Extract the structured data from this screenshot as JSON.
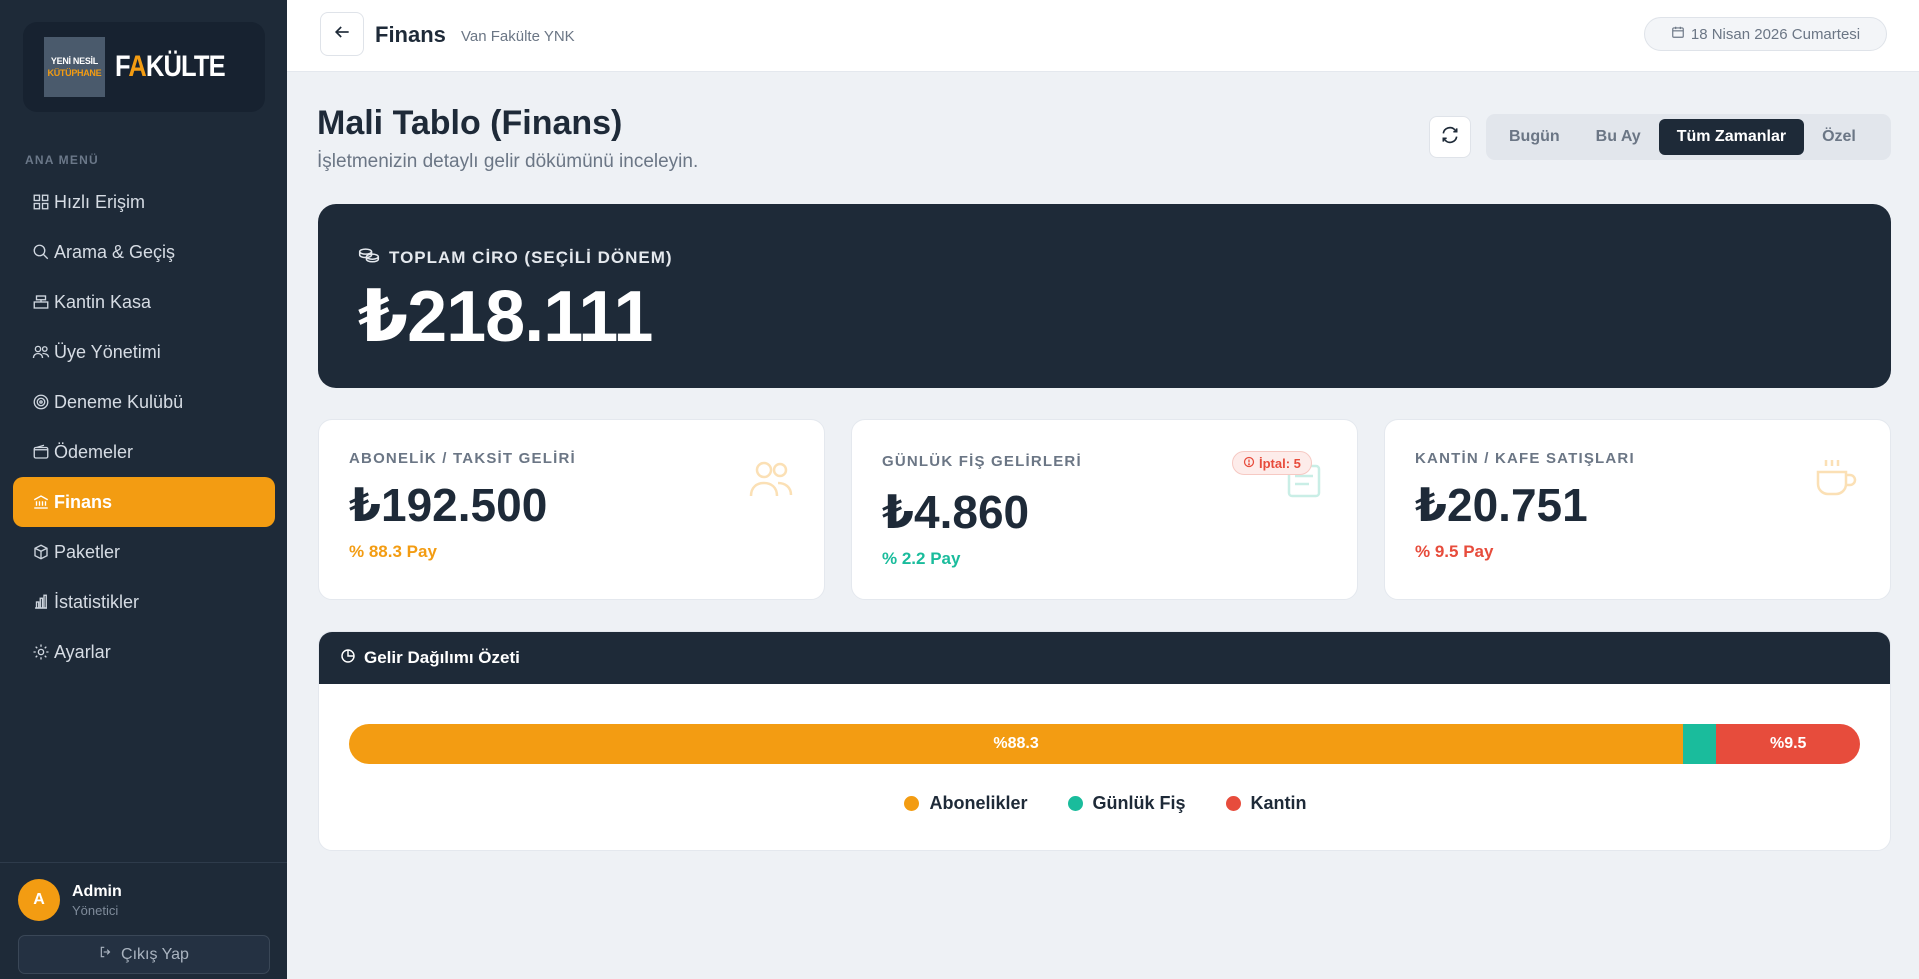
{
  "colors": {
    "accent": "#f39c12",
    "dark": "#1e2a38",
    "teal": "#1abc9c",
    "red": "#e74c3c"
  },
  "sidebar": {
    "logo": {
      "badge_line1": "YENİ NESİL",
      "badge_line2": "KÜTÜPHANE",
      "word_a": "F",
      "word_b": "A",
      "word_c": "KÜLTE"
    },
    "menu_label": "ANA MENÜ",
    "items": [
      {
        "label": "Hızlı Erişim",
        "icon": "grid-icon"
      },
      {
        "label": "Arama & Geçiş",
        "icon": "search-icon"
      },
      {
        "label": "Kantin Kasa",
        "icon": "cash-register-icon"
      },
      {
        "label": "Üye Yönetimi",
        "icon": "users-icon"
      },
      {
        "label": "Deneme Kulübü",
        "icon": "target-icon"
      },
      {
        "label": "Ödemeler",
        "icon": "wallet-icon"
      },
      {
        "label": "Finans",
        "icon": "bank-icon",
        "active": true
      },
      {
        "label": "Paketler",
        "icon": "package-icon"
      },
      {
        "label": "İstatistikler",
        "icon": "bar-chart-icon"
      },
      {
        "label": "Ayarlar",
        "icon": "gear-icon"
      }
    ],
    "user": {
      "initial": "A",
      "name": "Admin",
      "role": "Yönetici"
    },
    "logout_label": "Çıkış Yap"
  },
  "topbar": {
    "title": "Finans",
    "subtitle": "Van Fakülte YNK",
    "date": "18 Nisan 2026 Cumartesi"
  },
  "page": {
    "title": "Mali Tablo (Finans)",
    "subtitle": "İşletmenizin detaylı gelir dökümünü inceleyin.",
    "periods": [
      "Bugün",
      "Bu Ay",
      "Tüm Zamanlar",
      "Özel"
    ],
    "active_period": "Tüm Zamanlar"
  },
  "total": {
    "label": "TOPLAM CİRO (SEÇİLİ DÖNEM)",
    "value": "₺218.111"
  },
  "stats": [
    {
      "label": "ABONELİK / TAKSİT GELİRİ",
      "value": "₺192.500",
      "pay": "% 88.3 Pay",
      "icon": "users-icon"
    },
    {
      "label": "GÜNLÜK FİŞ GELİRLERİ",
      "value": "₺4.860",
      "pay": "% 2.2 Pay",
      "icon": "ticket-icon",
      "badge": "İptal: 5"
    },
    {
      "label": "KANTİN / KAFE SATIŞLARI",
      "value": "₺20.751",
      "pay": "% 9.5 Pay",
      "icon": "coffee-icon"
    }
  ],
  "distribution": {
    "title": "Gelir Dağılımı Özeti",
    "segments": [
      {
        "name": "Abonelikler",
        "percent": 88.3,
        "label": "%88.3"
      },
      {
        "name": "Günlük Fiş",
        "percent": 2.2,
        "label": ""
      },
      {
        "name": "Kantin",
        "percent": 9.5,
        "label": "%9.5"
      }
    ]
  }
}
